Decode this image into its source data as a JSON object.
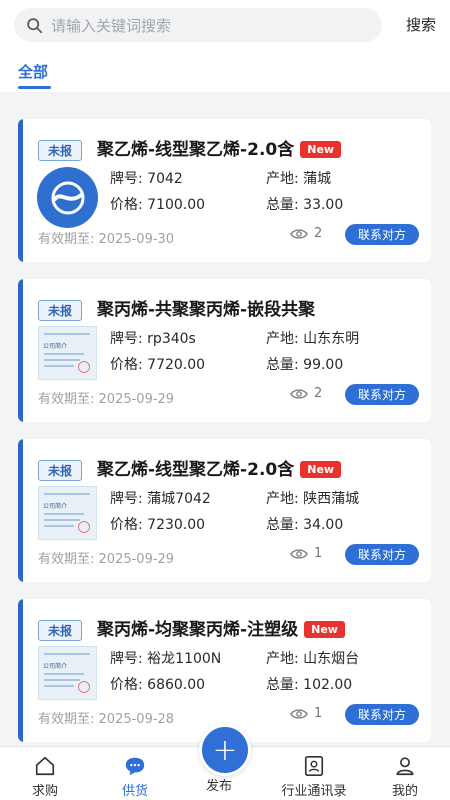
{
  "search": {
    "placeholder": "请输入关键词搜索",
    "button": "搜索"
  },
  "tabs": {
    "all": "全部"
  },
  "labels": {
    "brand": "牌号:",
    "origin": "产地:",
    "price": "价格:",
    "total": "总量:",
    "expiry": "有效期至:",
    "contact": "联系对方",
    "new": "New"
  },
  "listings": [
    {
      "status": "未报",
      "title": "聚乙烯-线型聚乙烯-2.0含",
      "is_new": true,
      "thumb": "company-logo",
      "brand": "7042",
      "origin": "蒲城",
      "price": "7100.00",
      "total": "33.00",
      "expiry": "2025-09-30",
      "views": "2"
    },
    {
      "status": "未报",
      "title": "聚丙烯-共聚聚丙烯-嵌段共聚",
      "is_new": false,
      "thumb": "certificate",
      "brand": "rp340s",
      "origin": "山东东明",
      "price": "7720.00",
      "total": "99.00",
      "expiry": "2025-09-29",
      "views": "2"
    },
    {
      "status": "未报",
      "title": "聚乙烯-线型聚乙烯-2.0含",
      "is_new": true,
      "thumb": "certificate",
      "brand": "蒲城7042",
      "origin": "陕西蒲城",
      "price": "7230.00",
      "total": "34.00",
      "expiry": "2025-09-29",
      "views": "1"
    },
    {
      "status": "未报",
      "title": "聚丙烯-均聚聚丙烯-注塑级",
      "is_new": true,
      "thumb": "certificate",
      "brand": "裕龙1100N",
      "origin": "山东烟台",
      "price": "6860.00",
      "total": "102.00",
      "expiry": "2025-09-28",
      "views": "1"
    }
  ],
  "cert_text": "公司简介",
  "nav": [
    {
      "label": "求购",
      "icon": "home-icon",
      "active": false
    },
    {
      "label": "供货",
      "icon": "chat-icon",
      "active": true
    },
    {
      "label": "发布",
      "icon": "plus-icon",
      "active": false
    },
    {
      "label": "行业通讯录",
      "icon": "contacts-icon",
      "active": false
    },
    {
      "label": "我的",
      "icon": "user-icon",
      "active": false
    }
  ],
  "colors": {
    "accent": "#2e6fd6",
    "new_badge": "#e8322f",
    "status_border": "#7aa3d6"
  }
}
